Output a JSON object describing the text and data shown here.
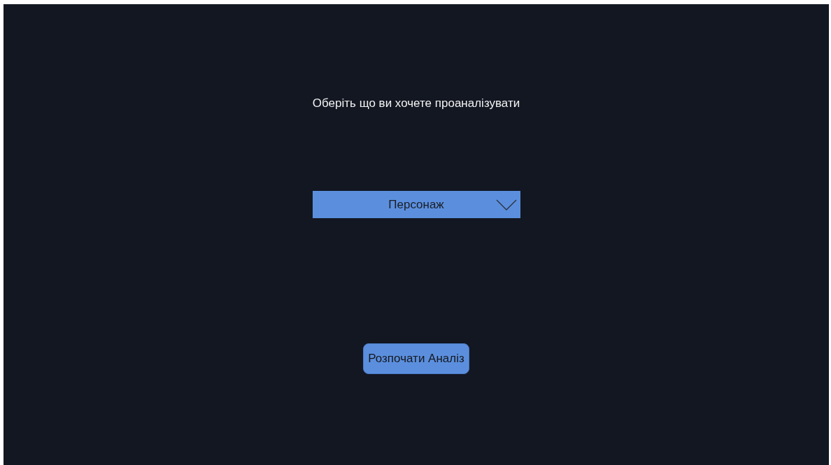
{
  "prompt": "Оберіть що ви хочете проаналізувати",
  "dropdown": {
    "value": "Персонаж"
  },
  "buttons": [
    "Розпочати Аналіз"
  ]
}
